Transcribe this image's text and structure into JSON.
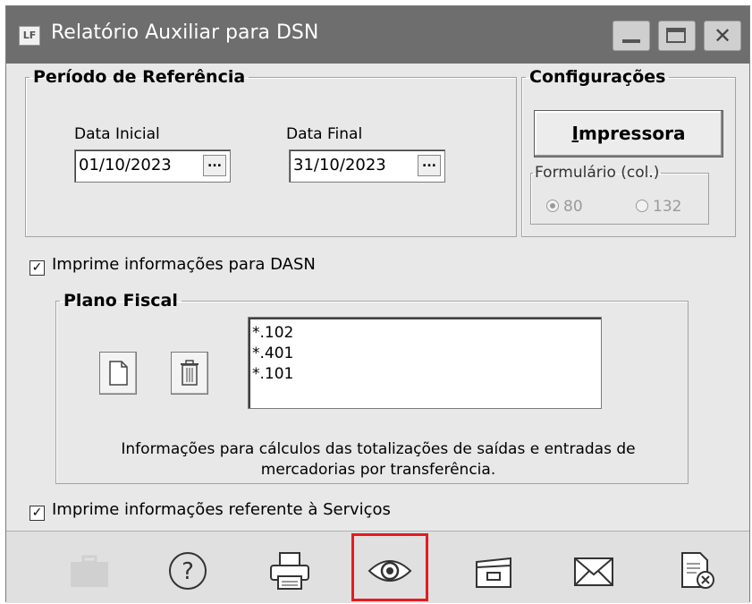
{
  "window": {
    "title": "Relatório Auxiliar para DSN",
    "app_icon_text": "LF"
  },
  "periodo": {
    "legend": "Período de Referência",
    "data_inicial_label": "Data Inicial",
    "data_inicial_value": "01/10/2023",
    "data_final_label": "Data Final",
    "data_final_value": "31/10/2023",
    "picker_label": "..."
  },
  "configuracoes": {
    "legend": "Configurações",
    "printer_button": "Impressora",
    "formulario_legend": "Formulário (col.)",
    "option_80": "80",
    "option_132": "132",
    "selected": "80"
  },
  "dasn": {
    "checkbox_label": "Imprime informações para DASN",
    "checked": true
  },
  "plano_fiscal": {
    "legend": "Plano Fiscal",
    "items": [
      "*.102",
      "*.401",
      "*.101"
    ],
    "info_line1": "Informações para cálculos das totalizações  de saídas e entradas de",
    "info_line2": "mercadorias por transferência."
  },
  "servicos": {
    "checkbox_label": "Imprime informações referente à Serviços",
    "checked": true
  },
  "toolbar": {
    "icons": [
      "briefcase-icon",
      "help-icon",
      "printer-icon",
      "preview-eye-icon",
      "archive-icon",
      "email-icon",
      "close-document-icon"
    ],
    "highlight_color": "#e21c22"
  }
}
